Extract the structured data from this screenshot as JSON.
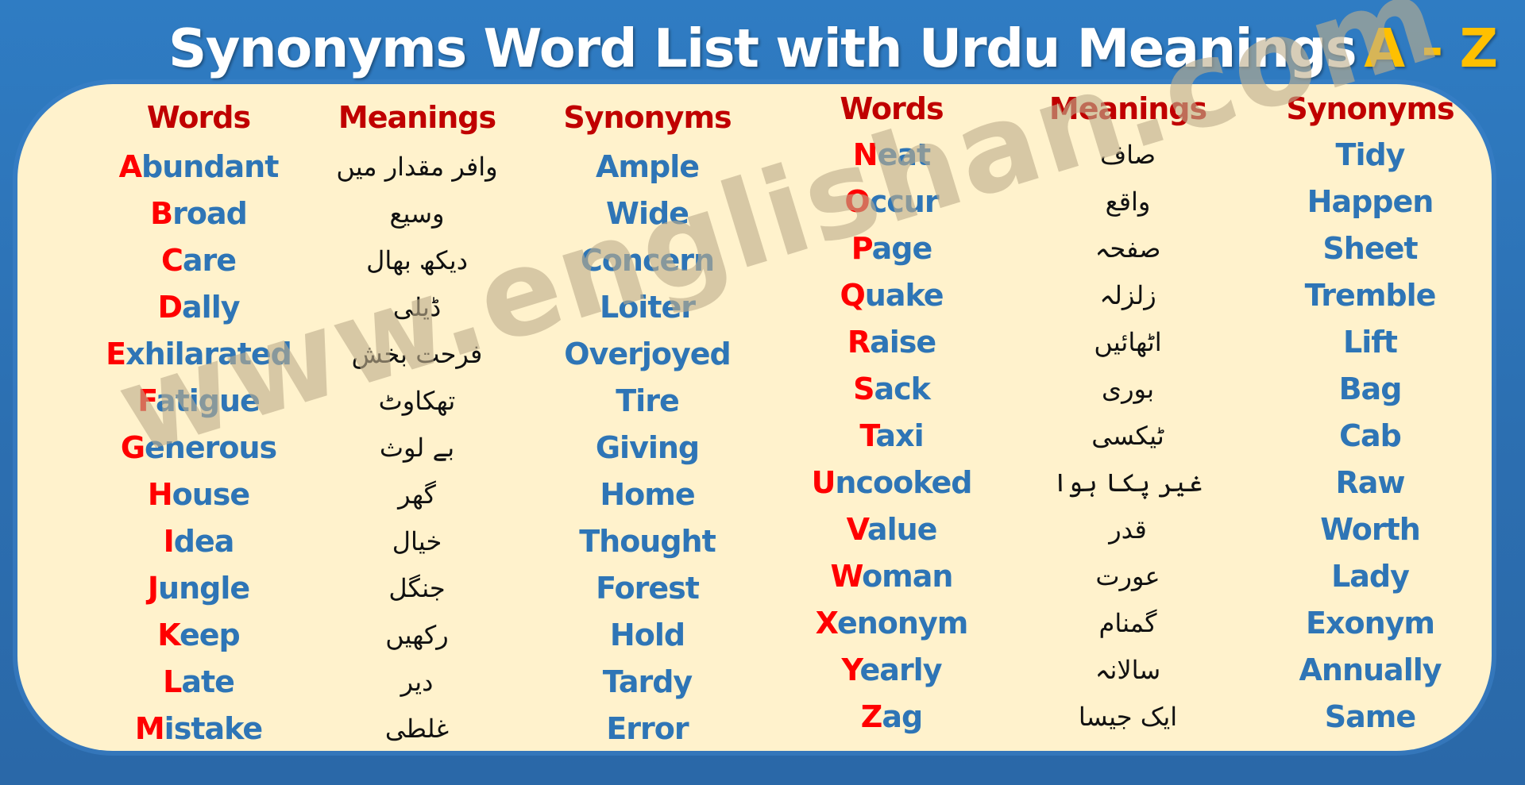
{
  "title": {
    "main": "Synonyms Word List with  Urdu Meanings",
    "range": "A - Z"
  },
  "colors": {
    "background": "#2c6fb1",
    "panel": "#fff2cc",
    "header": "#c00000",
    "initial_letter": "#ff0000",
    "word_text": "#2e75b6",
    "title_accent": "#ffc000"
  },
  "headers": {
    "words": "Words",
    "meanings": "Meanings",
    "synonyms": "Synonyms"
  },
  "left_table": [
    {
      "initial": "A",
      "rest": "bundant",
      "meaning": "وافر مقدار میں",
      "synonym": "Ample"
    },
    {
      "initial": "B",
      "rest": "road",
      "meaning": "وسیع",
      "synonym": "Wide"
    },
    {
      "initial": "C",
      "rest": "are",
      "meaning": "دیکھ بھال",
      "synonym": "Concern"
    },
    {
      "initial": "D",
      "rest": "ally",
      "meaning": "ڈیلی",
      "synonym": "Loiter"
    },
    {
      "initial": "E",
      "rest": "xhilarated",
      "meaning": "فرحت بخش",
      "synonym": "Overjoyed"
    },
    {
      "initial": "F",
      "rest": "atigue",
      "meaning": "تھکاوٹ",
      "synonym": "Tire"
    },
    {
      "initial": "G",
      "rest": "enerous",
      "meaning": "بے لوث",
      "synonym": "Giving"
    },
    {
      "initial": "H",
      "rest": "ouse",
      "meaning": "گھر",
      "synonym": "Home"
    },
    {
      "initial": "I",
      "rest": "dea",
      "meaning": "خیال",
      "synonym": "Thought"
    },
    {
      "initial": "J",
      "rest": "ungle",
      "meaning": "جنگل",
      "synonym": "Forest"
    },
    {
      "initial": "K",
      "rest": "eep",
      "meaning": "رکھیں",
      "synonym": "Hold"
    },
    {
      "initial": "L",
      "rest": "ate",
      "meaning": "دیر",
      "synonym": "Tardy"
    },
    {
      "initial": "M",
      "rest": "istake",
      "meaning": "غلطی",
      "synonym": "Error"
    }
  ],
  "right_table": [
    {
      "initial": "N",
      "rest": "eat",
      "meaning": "صاف",
      "synonym": "Tidy"
    },
    {
      "initial": "O",
      "rest": "ccur",
      "meaning": "واقع",
      "synonym": "Happen"
    },
    {
      "initial": "P",
      "rest": "age",
      "meaning": "صفحہ",
      "synonym": "Sheet"
    },
    {
      "initial": "Q",
      "rest": "uake",
      "meaning": "زلزلہ",
      "synonym": "Tremble"
    },
    {
      "initial": "R",
      "rest": "aise",
      "meaning": "اٹھائیں",
      "synonym": "Lift"
    },
    {
      "initial": "S",
      "rest": "ack",
      "meaning": "بوری",
      "synonym": "Bag"
    },
    {
      "initial": "T",
      "rest": "axi",
      "meaning": "ٹیکسی",
      "synonym": "Cab"
    },
    {
      "initial": "U",
      "rest": "ncooked",
      "meaning": "غیر پکا ہوا",
      "synonym": "Raw"
    },
    {
      "initial": "V",
      "rest": "alue",
      "meaning": "قدر",
      "synonym": "Worth"
    },
    {
      "initial": "W",
      "rest": "oman",
      "meaning": "عورت",
      "synonym": "Lady"
    },
    {
      "initial": "X",
      "rest": "enonym",
      "meaning": "گمنام",
      "synonym": "Exonym"
    },
    {
      "initial": "Y",
      "rest": "early",
      "meaning": "سالانہ",
      "synonym": "Annually"
    },
    {
      "initial": "Z",
      "rest": "ag",
      "meaning": "ایک جیسا",
      "synonym": "Same"
    }
  ],
  "watermark": "www.englishan.com"
}
